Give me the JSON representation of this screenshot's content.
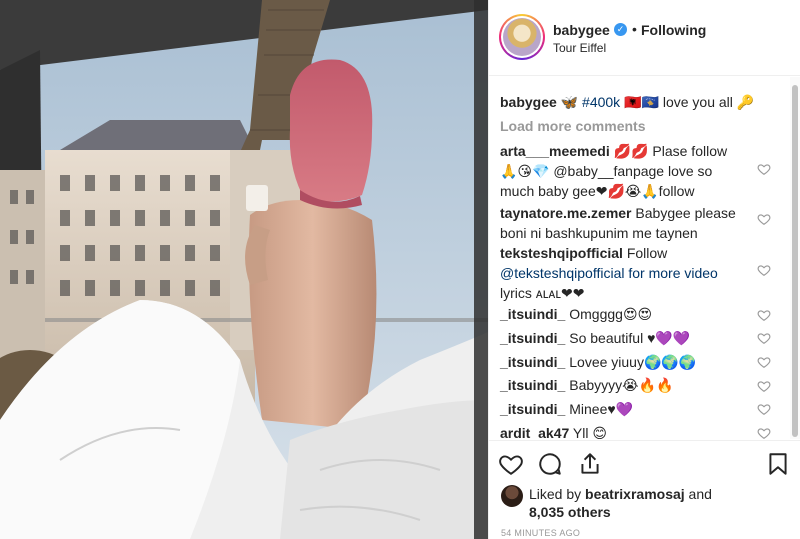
{
  "post": {
    "username": "babygee",
    "follow_status": "Following",
    "separator": "•",
    "location": "Tour Eiffel"
  },
  "caption": {
    "username": "babygee",
    "hashtag": "#400k",
    "text_before": "🦋",
    "text_after": "🇦🇱🇽🇰 love you all 🔑"
  },
  "load_more_label": "Load more comments",
  "comments": [
    {
      "user": "arta___meemedi",
      "lines": [
        "💋💋 Plase follow",
        "🙏😘💎 @baby__fanpage love so",
        "much baby gee❤💋😭🙏follow"
      ]
    },
    {
      "user": "taynatore.me.zemer",
      "lines": [
        "Babygee please",
        "boni ni bashkupunim me taynen"
      ]
    },
    {
      "user": "teksteshqipofficial",
      "lines": [
        "Follow",
        "@teksteshqipofficial for more video",
        "lyrics ᴀʟᴀʟ❤❤"
      ]
    },
    {
      "user": "_itsuindi_",
      "lines": [
        "Omgggg😍😍"
      ]
    },
    {
      "user": "_itsuindi_",
      "lines": [
        "So beautiful ♥💜💜"
      ]
    },
    {
      "user": "_itsuindi_",
      "lines": [
        "Lovee yiuuy🌍🌍🌍"
      ]
    },
    {
      "user": "_itsuindi_",
      "lines": [
        "Babyyyy😭🔥🔥"
      ]
    },
    {
      "user": "_itsuindi_",
      "lines": [
        "Minee♥💜"
      ]
    },
    {
      "user": "ardit_ak47",
      "lines": [
        "Yll 😊"
      ]
    }
  ],
  "likes": {
    "prefix": "Liked by",
    "user": "beatrixramosaj",
    "conj": "and",
    "others": "8,035 others"
  },
  "timestamp": "54 MINUTES AGO",
  "icons": {
    "like": "heart-outline-icon",
    "comment": "speech-bubble-icon",
    "share": "share-icon",
    "save": "bookmark-icon",
    "verified": "verified-badge-icon"
  },
  "colors": {
    "verified": "#3897f0",
    "link": "#003569",
    "muted": "#999999",
    "text": "#262626"
  }
}
